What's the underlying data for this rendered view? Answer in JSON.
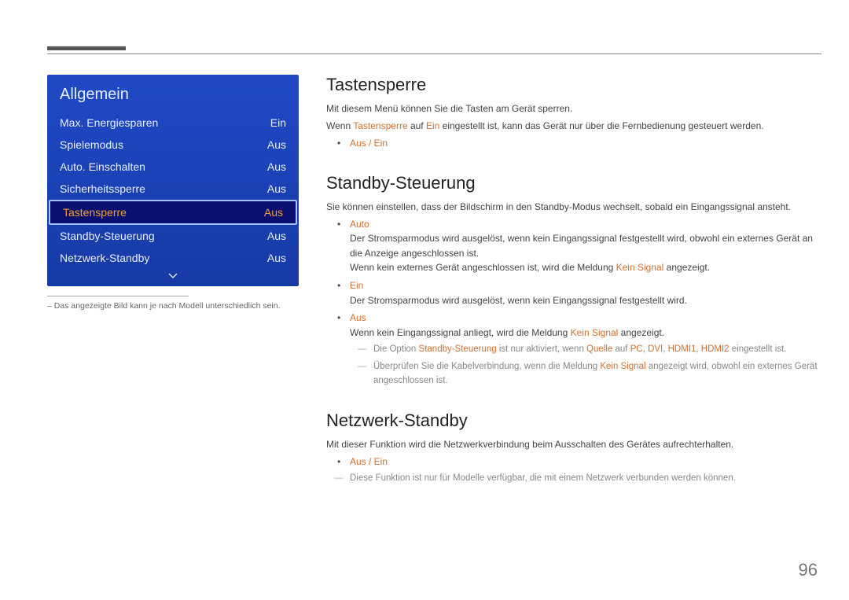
{
  "pageNumber": "96",
  "menu": {
    "title": "Allgemein",
    "items": [
      {
        "label": "Max. Energiesparen",
        "value": "Ein",
        "selected": false
      },
      {
        "label": "Spielemodus",
        "value": "Aus",
        "selected": false
      },
      {
        "label": "Auto. Einschalten",
        "value": "Aus",
        "selected": false
      },
      {
        "label": "Sicherheitssperre",
        "value": "Aus",
        "selected": false
      },
      {
        "label": "Tastensperre",
        "value": "Aus",
        "selected": true
      },
      {
        "label": "Standby-Steuerung",
        "value": "Aus",
        "selected": false
      },
      {
        "label": "Netzwerk-Standby",
        "value": "Aus",
        "selected": false
      }
    ]
  },
  "figureNote": "Das angezeigte Bild kann je nach Modell unterschiedlich sein.",
  "sections": {
    "tastensperre": {
      "title": "Tastensperre",
      "p1": "Mit diesem Menü können Sie die Tasten am Gerät sperren.",
      "p2a": "Wenn ",
      "p2b": "Tastensperre",
      "p2c": " auf ",
      "p2d": "Ein",
      "p2e": " eingestellt ist, kann das Gerät nur über die Fernbedienung gesteuert werden.",
      "bullet": "Aus / Ein"
    },
    "standby": {
      "title": "Standby-Steuerung",
      "p1": "Sie können einstellen, dass der Bildschirm in den Standby-Modus wechselt, sobald ein Eingangssignal ansteht.",
      "autoTerm": "Auto",
      "autoDesc1": "Der Stromsparmodus wird ausgelöst, wenn kein Eingangssignal festgestellt wird, obwohl ein externes Gerät an die Anzeige angeschlossen ist.",
      "autoDesc2a": "Wenn kein externes Gerät angeschlossen ist, wird die Meldung ",
      "autoDesc2b": "Kein Signal",
      "autoDesc2c": " angezeigt.",
      "einTerm": "Ein",
      "einDesc": "Der Stromsparmodus wird ausgelöst, wenn kein Eingangssignal festgestellt wird.",
      "ausTerm": "Aus",
      "ausDesc1a": "Wenn kein Eingangssignal anliegt, wird die Meldung ",
      "ausDesc1b": "Kein Signal",
      "ausDesc1c": " angezeigt.",
      "note1a": "Die Option ",
      "note1b": "Standby-Steuerung",
      "note1c": " ist nur aktiviert, wenn ",
      "note1d": "Quelle",
      "note1e": " auf ",
      "note1f": "PC",
      "note1g": "DVI",
      "note1h": "HDMI1",
      "note1i": "HDMI2",
      "note1j": " eingestellt ist.",
      "note2a": "Überprüfen Sie die Kabelverbindung, wenn die Meldung ",
      "note2b": "Kein Signal",
      "note2c": " angezeigt wird, obwohl ein externes Gerät angeschlossen ist."
    },
    "netzwerk": {
      "title": "Netzwerk-Standby",
      "p1": "Mit dieser Funktion wird die Netzwerkverbindung beim Ausschalten des Gerätes aufrechterhalten.",
      "bullet": "Aus / Ein",
      "note": "Diese Funktion ist nur für Modelle verfügbar, die mit einem Netzwerk verbunden werden können."
    }
  }
}
